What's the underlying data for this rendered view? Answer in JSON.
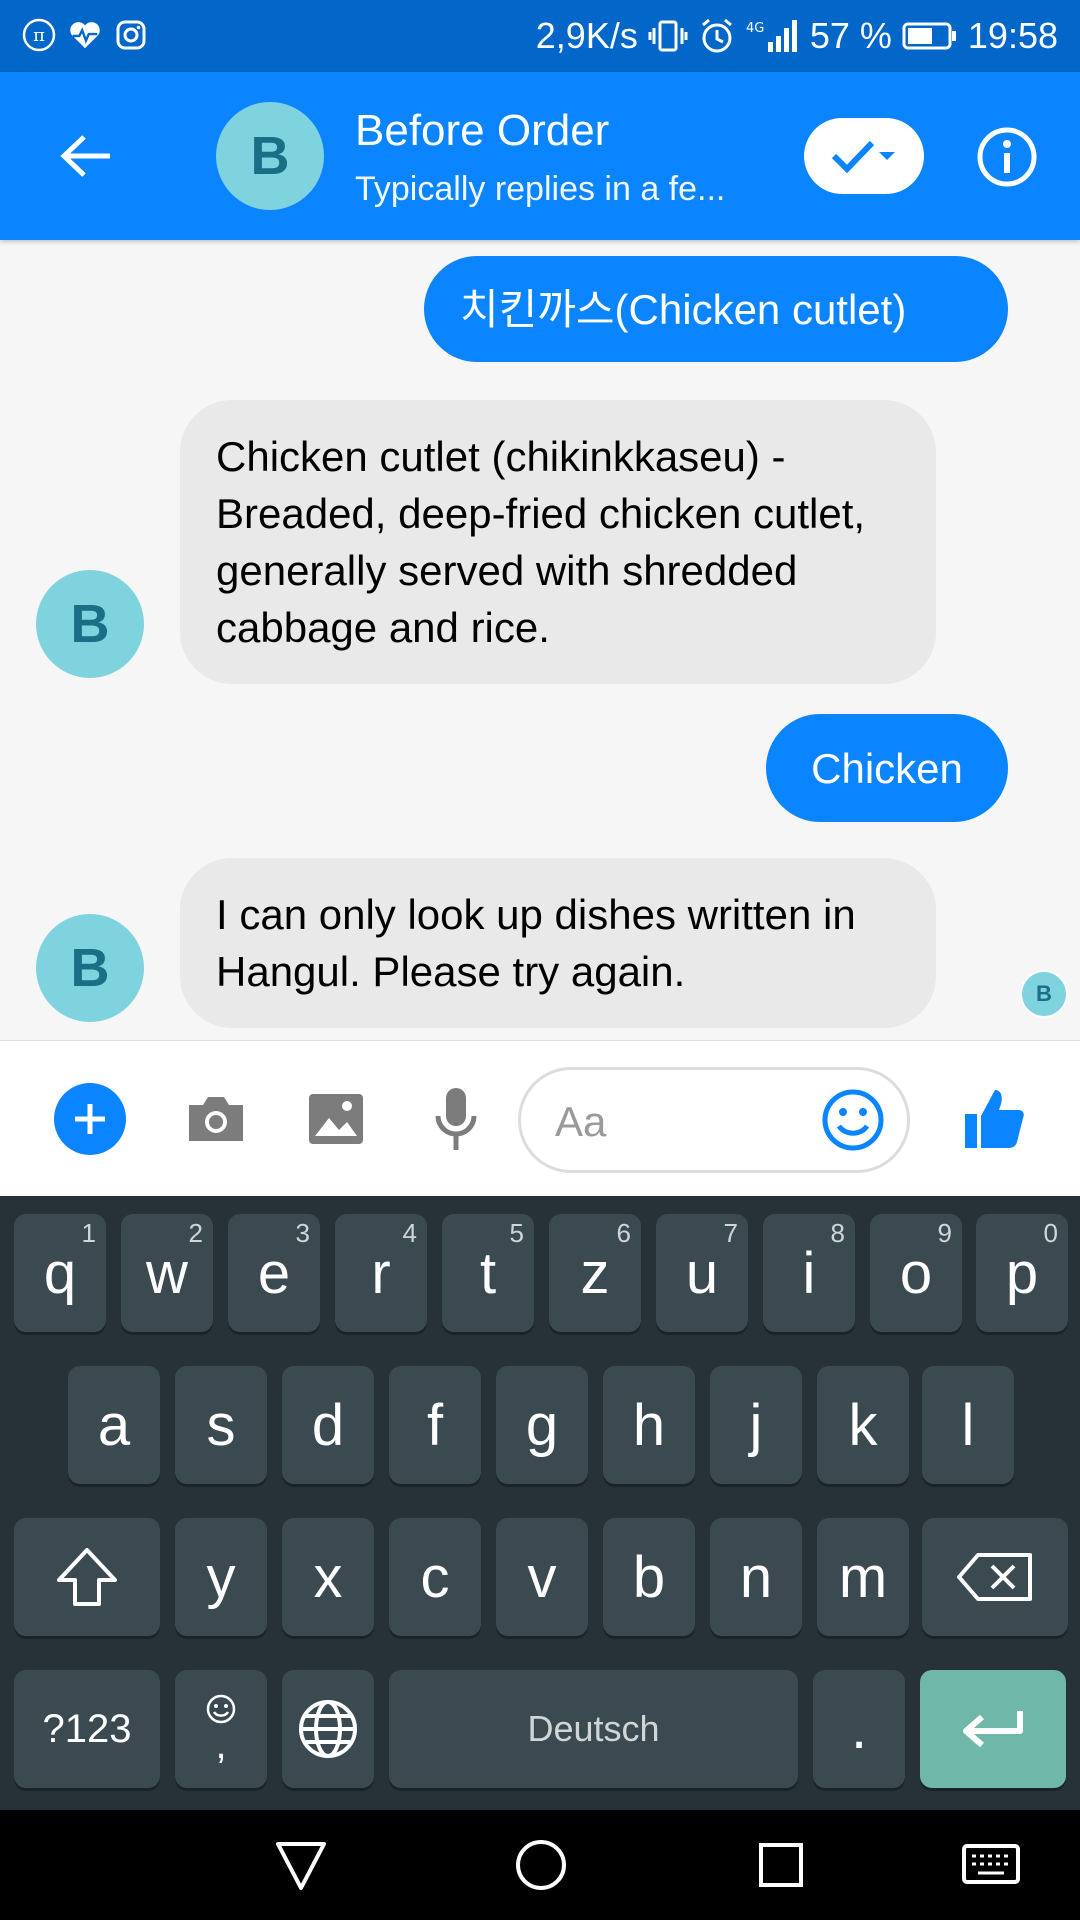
{
  "status_bar": {
    "speed": "2,9K/s",
    "battery": "57 %",
    "time": "19:58",
    "network": "4G"
  },
  "header": {
    "avatar_letter": "B",
    "title": "Before Order",
    "subtitle": "Typically replies in a fe..."
  },
  "messages": [
    {
      "from": "user",
      "text": "치킨까스(Chicken cutlet)"
    },
    {
      "from": "bot",
      "avatar": "B",
      "text": "Chicken cutlet (chikinkkaseu) - Breaded, deep-fried chicken cutlet, generally served with shredded cabbage and rice."
    },
    {
      "from": "user",
      "text": "Chicken"
    },
    {
      "from": "bot",
      "avatar": "B",
      "text": "I can only look up dishes written in Hangul. Please try again."
    }
  ],
  "seen_avatar": "B",
  "composer": {
    "placeholder": "Aa"
  },
  "keyboard": {
    "row1": [
      {
        "key": "q",
        "num": "1"
      },
      {
        "key": "w",
        "num": "2"
      },
      {
        "key": "e",
        "num": "3"
      },
      {
        "key": "r",
        "num": "4"
      },
      {
        "key": "t",
        "num": "5"
      },
      {
        "key": "z",
        "num": "6"
      },
      {
        "key": "u",
        "num": "7"
      },
      {
        "key": "i",
        "num": "8"
      },
      {
        "key": "o",
        "num": "9"
      },
      {
        "key": "p",
        "num": "0"
      }
    ],
    "row2": [
      "a",
      "s",
      "d",
      "f",
      "g",
      "h",
      "j",
      "k",
      "l"
    ],
    "row3": [
      "y",
      "x",
      "c",
      "v",
      "b",
      "n",
      "m"
    ],
    "symbols_label": "?123",
    "comma": ",",
    "space_label": "Deutsch",
    "period": "."
  },
  "colors": {
    "status_bar": "#0267c8",
    "header": "#0a84ff",
    "user_bubble": "#0a84ff",
    "bot_bubble": "#e9e9e9",
    "avatar": "#7fd3df",
    "keyboard": "#263238",
    "key": "#3b4a50",
    "enter_key": "#6fb7a9"
  }
}
